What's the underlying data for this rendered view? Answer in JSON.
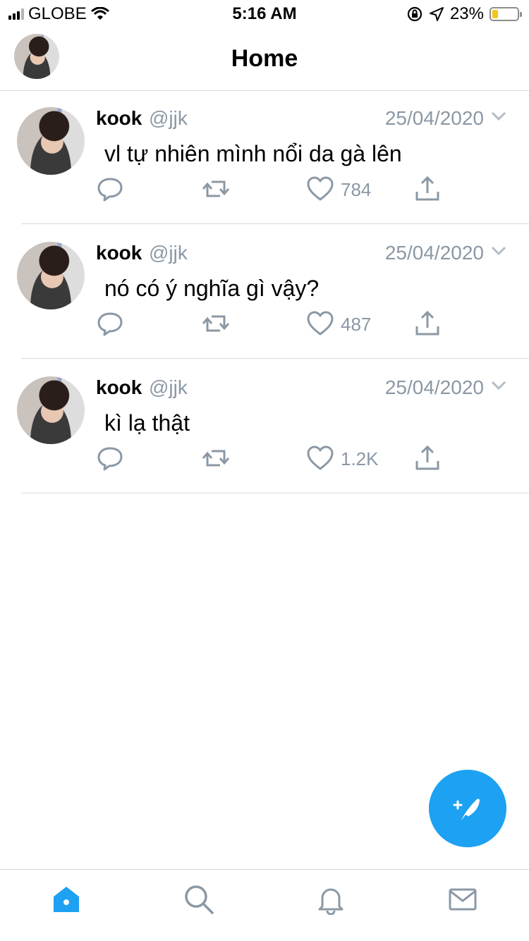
{
  "status_bar": {
    "carrier": "GLOBE",
    "time": "5:16 AM",
    "battery_percent": "23%",
    "battery_level": 0.23,
    "icons": [
      "signal-icon",
      "wifi-icon",
      "orientation-lock-icon",
      "location-icon",
      "battery-icon"
    ]
  },
  "header": {
    "title": "Home"
  },
  "tweets": [
    {
      "name": "kook",
      "handle": "@jjk",
      "date": "25/04/2020",
      "text": "vl tự nhiên mình nổi da gà lên",
      "likes": "784"
    },
    {
      "name": "kook",
      "handle": "@jjk",
      "date": "25/04/2020",
      "text": "nó có ý nghĩa gì vậy?",
      "likes": "487"
    },
    {
      "name": "kook",
      "handle": "@jjk",
      "date": "25/04/2020",
      "text": "kì lạ thật",
      "likes": "1.2K"
    }
  ],
  "tabbar": {
    "items": [
      "home-icon",
      "search-icon",
      "notifications-icon",
      "messages-icon"
    ],
    "active": "home-icon"
  },
  "colors": {
    "accent": "#1da1f2",
    "icon_gray": "#8b98a5",
    "battery": "#f5c518"
  }
}
